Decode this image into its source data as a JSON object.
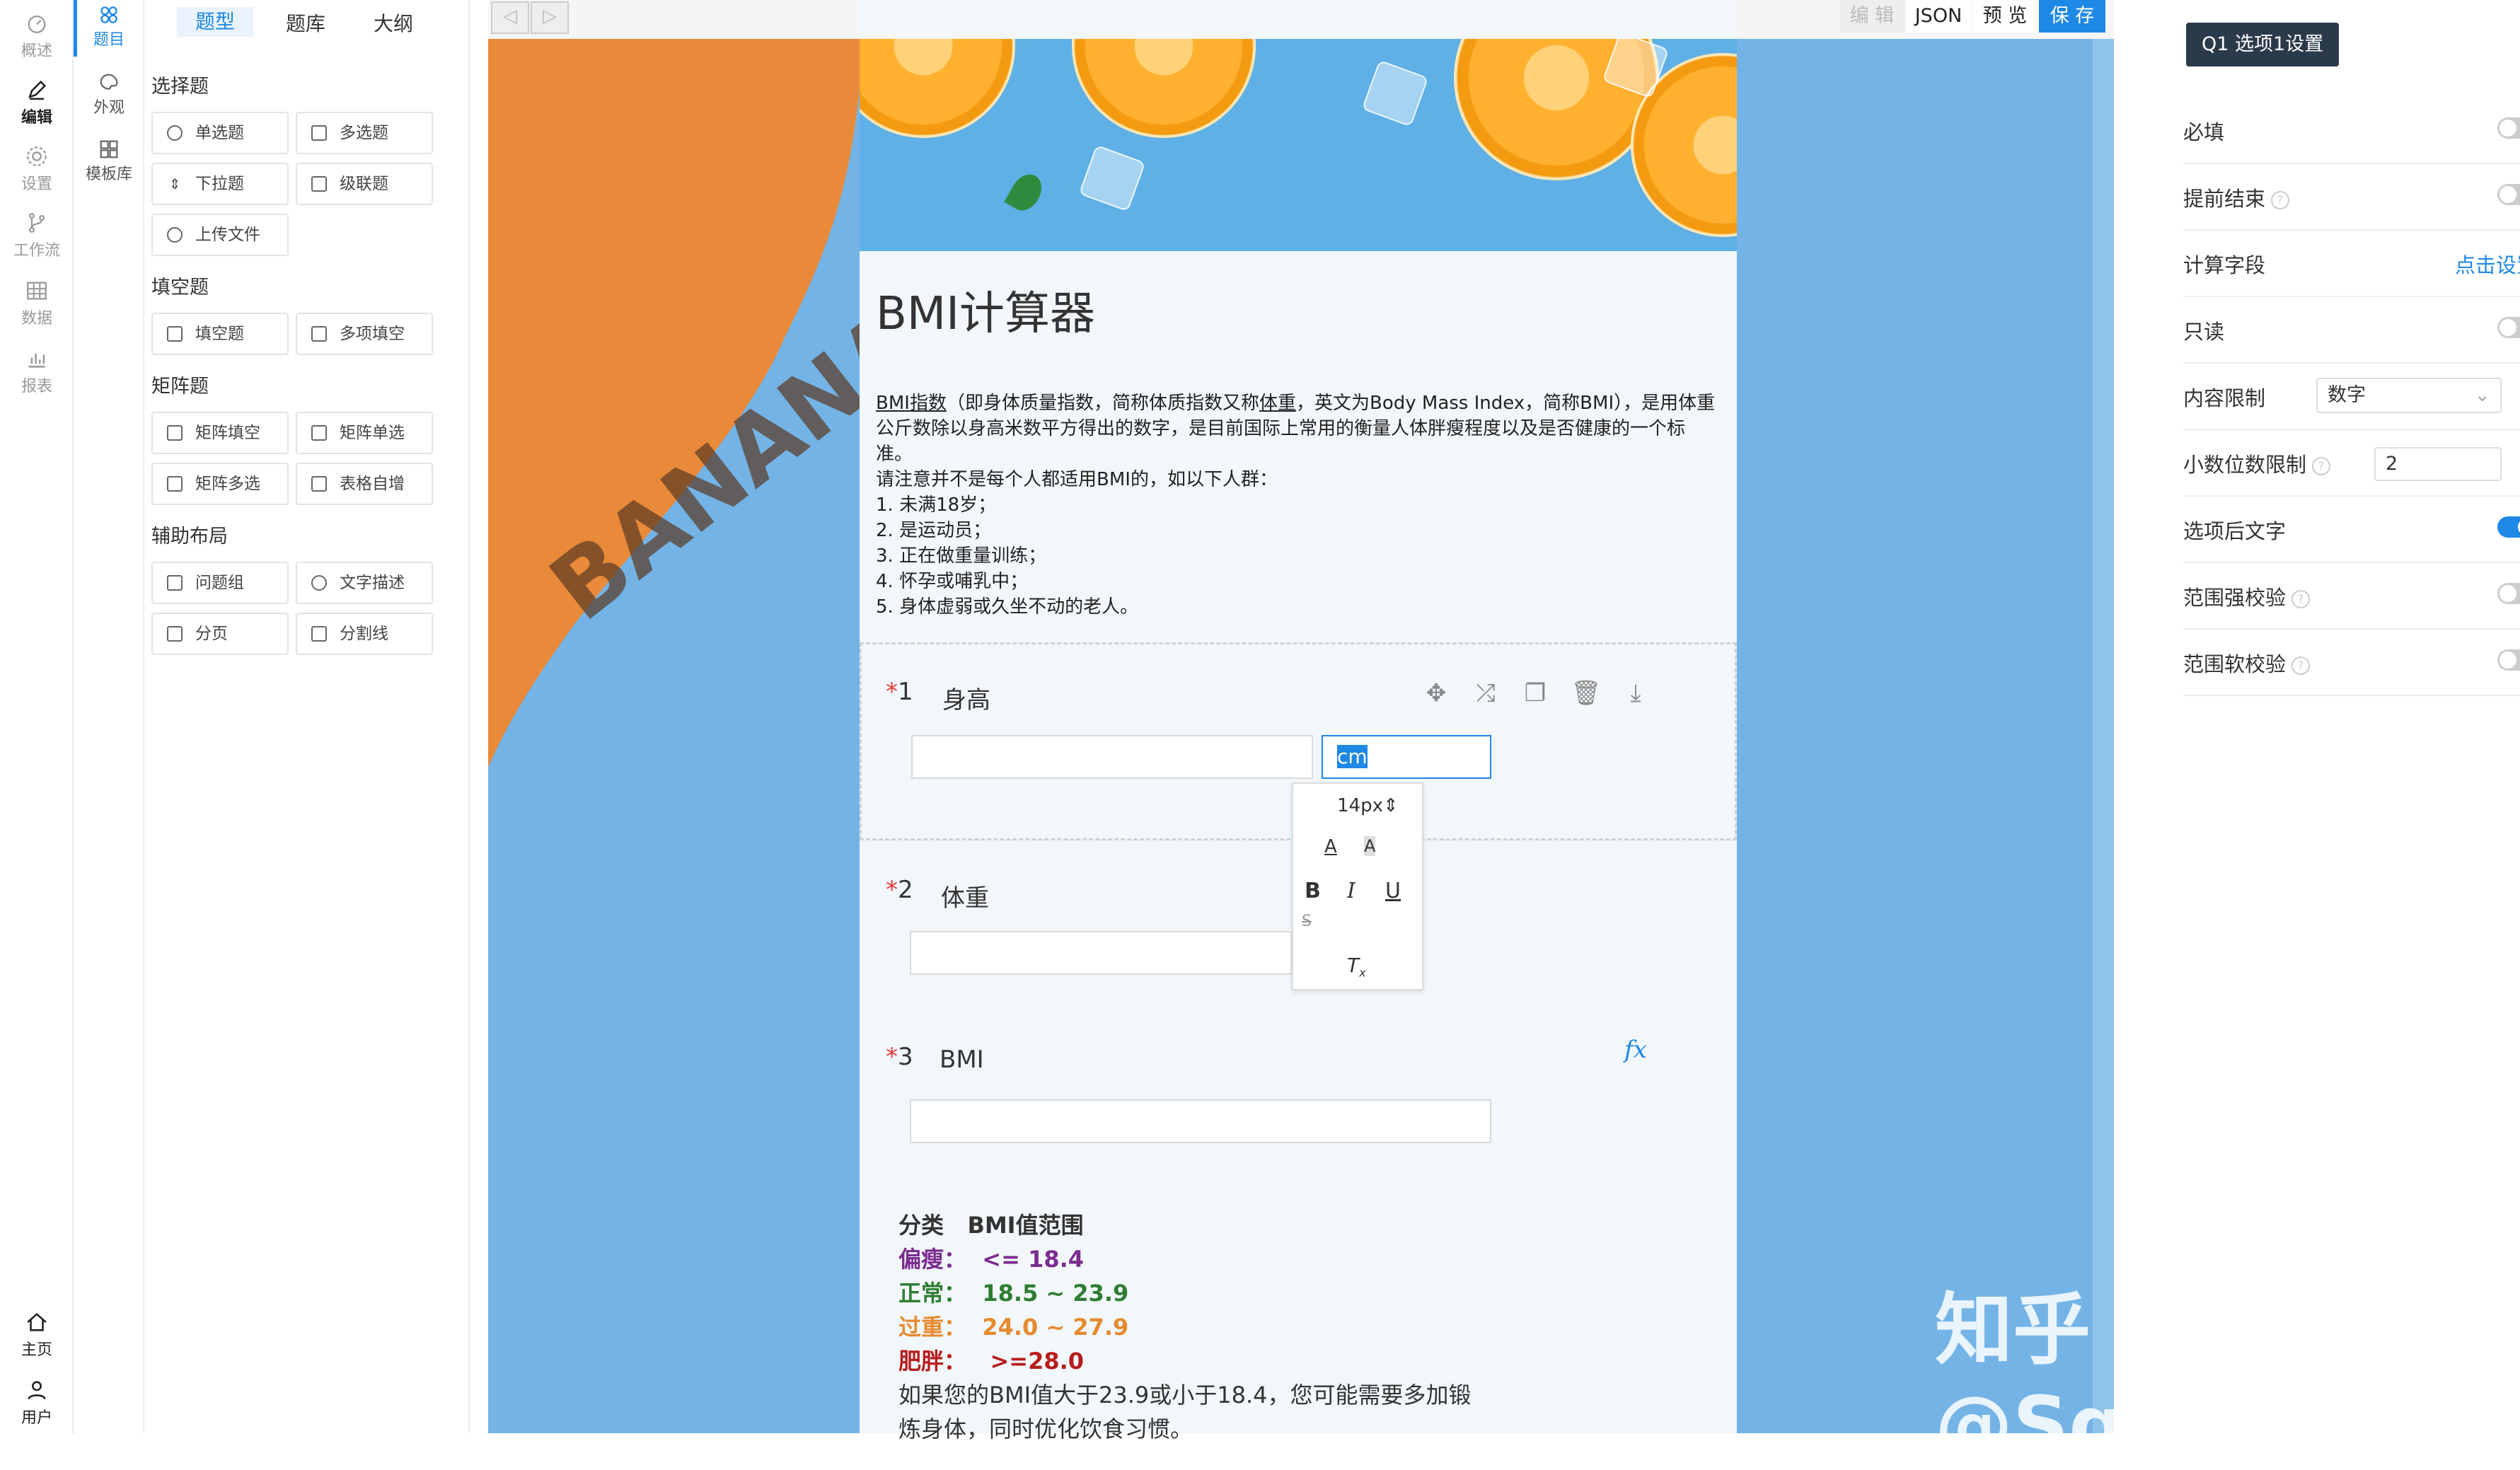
{
  "rail": {
    "items": [
      {
        "label": "概述",
        "icon": "dashboard-icon"
      },
      {
        "label": "编辑",
        "icon": "pencil-icon"
      },
      {
        "label": "设置",
        "icon": "gear-icon"
      },
      {
        "label": "工作流",
        "icon": "workflow-icon"
      },
      {
        "label": "数据",
        "icon": "grid-icon"
      },
      {
        "label": "报表",
        "icon": "chart-icon"
      }
    ],
    "bottom": [
      {
        "label": "主页",
        "icon": "home-icon"
      },
      {
        "label": "用户",
        "icon": "user-icon"
      }
    ]
  },
  "rail2": {
    "items": [
      {
        "label": "题目",
        "icon": "components-icon"
      },
      {
        "label": "外观",
        "icon": "palette-icon"
      },
      {
        "label": "模板库",
        "icon": "template-icon"
      }
    ]
  },
  "panel": {
    "tabs": [
      "题型",
      "题库",
      "大纲"
    ],
    "sections": {
      "choice": {
        "title": "选择题",
        "items": [
          "单选题",
          "多选题",
          "下拉题",
          "级联题",
          "上传文件"
        ]
      },
      "fill": {
        "title": "填空题",
        "items": [
          "填空题",
          "多项填空"
        ]
      },
      "matrix": {
        "title": "矩阵题",
        "items": [
          "矩阵填空",
          "矩阵单选",
          "矩阵多选",
          "表格自增"
        ]
      },
      "layout": {
        "title": "辅助布局",
        "items": [
          "问题组",
          "文字描述",
          "分页",
          "分割线"
        ]
      }
    }
  },
  "toolbar": {
    "edit": "编 辑",
    "json": "JSON",
    "preview": "预 览",
    "save": "保 存"
  },
  "form": {
    "title": "BMI计算器",
    "desc": {
      "bmi_link": "BMI指数",
      "p1a": "（即身体质量指数，简称体质指数又称",
      "p1b": "体重",
      "p1c": "，英文为Body Mass Index，简称BMI），是用体重公斤数除以身高米数平方得出的数字，是目前国际上常用的衡量人体胖瘦程度以及是否健康的一个标准。",
      "p2": "请注意并不是每个人都适用BMI的，如以下人群：",
      "list": [
        "1. 未满18岁；",
        "2. 是运动员；",
        "3. 正在做重量训练；",
        "4. 怀孕或哺乳中；",
        "5. 身体虚弱或久坐不动的老人。"
      ]
    },
    "questions": [
      {
        "num": "1",
        "label": "身高",
        "star": "*",
        "suffix": "cm"
      },
      {
        "num": "2",
        "label": "体重",
        "star": "*"
      },
      {
        "num": "3",
        "label": "BMI",
        "star": "*",
        "fx": "fx"
      }
    ],
    "popup": {
      "size": "14px"
    },
    "bmi_table": {
      "header_a": "分类",
      "header_b": "BMI值范围",
      "rows": [
        {
          "k": "偏瘦：",
          "v": "<= 18.4",
          "color": "#7b2c8f"
        },
        {
          "k": "正常：",
          "v": "18.5 ~ 23.9",
          "color": "#2e7d32"
        },
        {
          "k": "过重：",
          "v": "24.0 ~ 27.9",
          "color": "#e68a2e"
        },
        {
          "k": "肥胖：",
          "v": ">=28.0",
          "color": "#b71c1c"
        }
      ],
      "note1": "如果您的BMI值大于23.9或小于18.4，您可能需要多加锻",
      "note2": "炼身体，同时优化饮食习惯。"
    }
  },
  "settings": {
    "title": "Q1 选项1设置",
    "rows": [
      {
        "label": "必填",
        "type": "toggle",
        "on": false
      },
      {
        "label": "提前结束",
        "type": "toggle",
        "on": false,
        "help": true
      },
      {
        "label": "计算字段",
        "type": "link",
        "value": "点击设置"
      },
      {
        "label": "只读",
        "type": "toggle",
        "on": false
      },
      {
        "label": "内容限制",
        "type": "select",
        "value": "数字"
      },
      {
        "label": "小数位数限制",
        "type": "input",
        "value": "2",
        "help": true
      },
      {
        "label": "选项后文字",
        "type": "toggle",
        "on": true
      },
      {
        "label": "范围强校验",
        "type": "toggle",
        "on": false,
        "help": true
      },
      {
        "label": "范围软校验",
        "type": "toggle",
        "on": false,
        "help": true
      }
    ]
  },
  "watermark": "知乎 @SqlZero"
}
